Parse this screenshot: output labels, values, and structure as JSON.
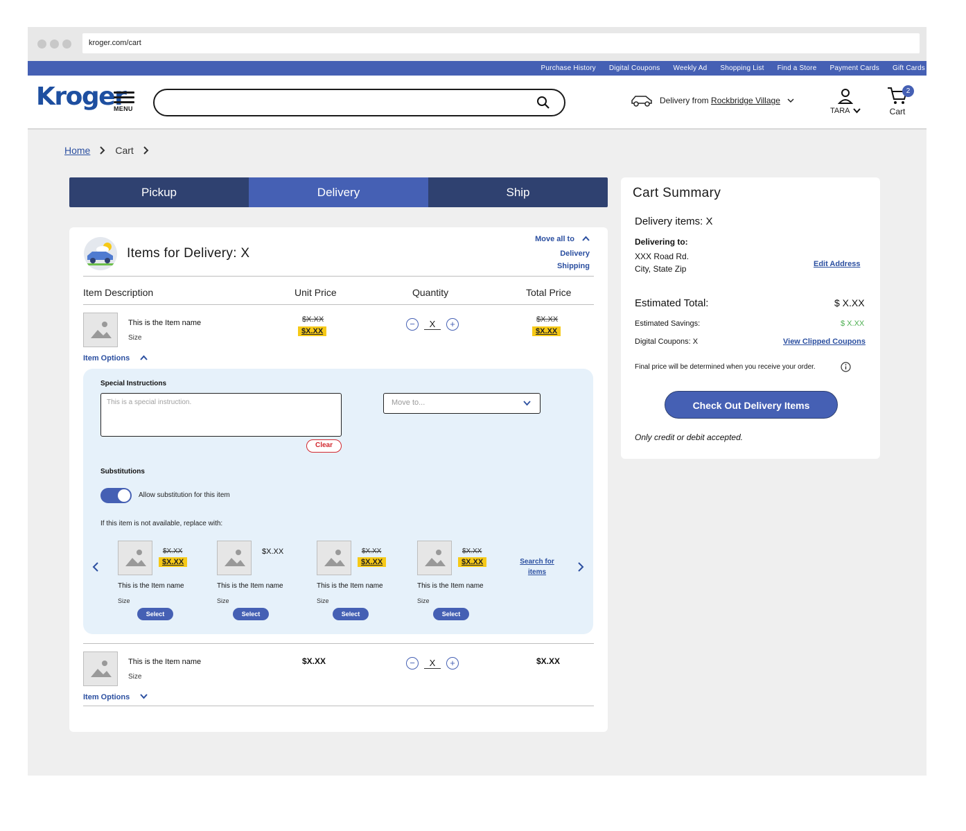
{
  "browser": {
    "url": "kroger.com/cart"
  },
  "topnav": [
    "Purchase History",
    "Digital Coupons",
    "Weekly Ad",
    "Shopping List",
    "Find a Store",
    "Payment Cards",
    "Gift Cards"
  ],
  "header": {
    "logo": "Kroger",
    "menu_label": "MENU",
    "search_placeholder": "",
    "delivery_prefix": "Delivery from",
    "delivery_store": "Rockbridge Village",
    "account_name": "TARA",
    "cart_label": "Cart",
    "cart_count": "2"
  },
  "breadcrumb": {
    "home": "Home",
    "current": "Cart"
  },
  "tabs": [
    {
      "label": "Pickup",
      "active": false
    },
    {
      "label": "Delivery",
      "active": true
    },
    {
      "label": "Ship",
      "active": false
    }
  ],
  "panel": {
    "title": "Items for Delivery: X",
    "move_all_label": "Move all to",
    "move_opt1": "Delivery",
    "move_opt2": "Shipping",
    "columns": [
      "Item Description",
      "Unit Price",
      "Quantity",
      "Total Price"
    ],
    "item1": {
      "name": "This is the Item name",
      "size": "Size",
      "unit_old": "$X.XX",
      "unit_sale": "$X.XX",
      "qty": "X",
      "total_old": "$X.XX",
      "total_sale": "$X.XX",
      "options_label": "Item Options"
    },
    "options": {
      "instructions_label": "Special Instructions",
      "instructions_placeholder": "This is a special instruction.",
      "clear_label": "Clear",
      "move_to": "Move to...",
      "substitutions_label": "Substitutions",
      "allow_sub": "Allow substitution for this item",
      "replace_label": "If this item is not available, replace with:",
      "search_link": "Search for items",
      "subs": [
        {
          "name": "This is the Item name",
          "size": "Size",
          "old": "$X.XX",
          "price": "$X.XX",
          "select": "Select"
        },
        {
          "name": "This is the Item name",
          "size": "Size",
          "price": "$X.XX",
          "select": "Select"
        },
        {
          "name": "This is the Item name",
          "size": "Size",
          "old": "$X.XX",
          "price": "$X.XX",
          "select": "Select"
        },
        {
          "name": "This is the Item name",
          "size": "Size",
          "old": "$X.XX",
          "price": "$X.XX",
          "select": "Select"
        }
      ]
    },
    "item2": {
      "name": "This is the Item name",
      "size": "Size",
      "unit": "$X.XX",
      "qty": "X",
      "total": "$X.XX",
      "options_label": "Item Options"
    }
  },
  "summary": {
    "title": "Cart Summary",
    "delivery_items": "Delivery items: X",
    "delivering_to": "Delivering to:",
    "addr1": "XXX Road Rd.",
    "addr2": "City, State Zip",
    "edit_address": "Edit Address",
    "estimated_total_label": "Estimated Total:",
    "estimated_total": "$ X.XX",
    "savings_label": "Estimated Savings:",
    "savings": "$ X.XX",
    "coupons_label": "Digital Coupons: X",
    "coupons_link": "View Clipped Coupons",
    "final_note": "Final price will be determined when you receive your order.",
    "checkout": "Check Out Delivery Items",
    "payment_note": "Only credit or debit accepted."
  },
  "colors": {
    "brand": "#4560b4",
    "navy": "#2f4170",
    "sale": "#f6c917",
    "savings": "#4caf50",
    "clear": "#d2272e"
  }
}
